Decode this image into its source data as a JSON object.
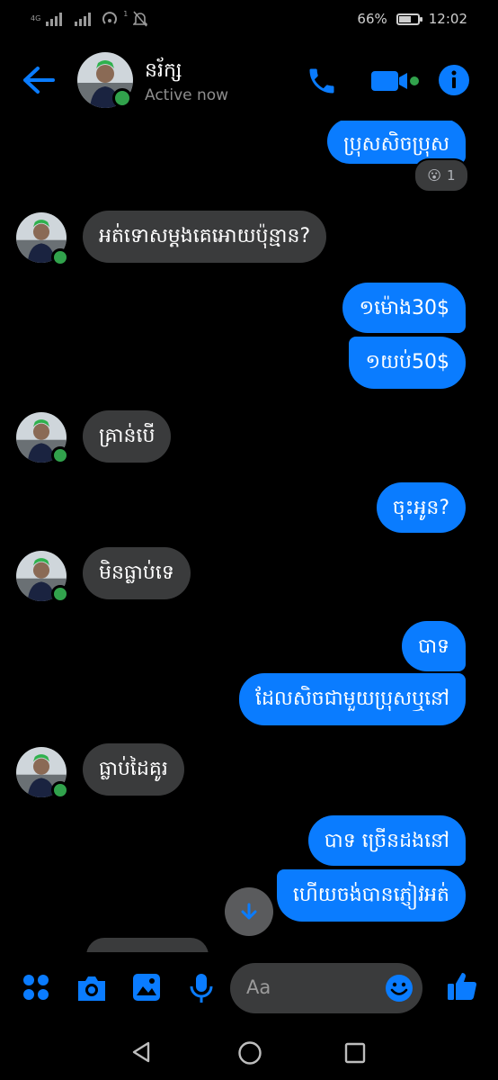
{
  "status_bar": {
    "network": "4G",
    "battery": "66%",
    "time": "12:02",
    "wifi_badge": "1"
  },
  "header": {
    "contact_name": "នរ័ក្ស",
    "presence": "Active now"
  },
  "messages": [
    {
      "side": "out",
      "text": "ប្រុសសិចប្រុស"
    },
    {
      "side": "in",
      "text": "អត់ទោសម្តងគេអោយប៉ុន្មាន?"
    },
    {
      "side": "out",
      "text": "១ម៉ោង30$"
    },
    {
      "side": "out",
      "text": "១យប់50$"
    },
    {
      "side": "in",
      "text": "គ្រាន់បើ"
    },
    {
      "side": "out",
      "text": "ចុះអូន?"
    },
    {
      "side": "in",
      "text": "មិនធ្លាប់ទេ"
    },
    {
      "side": "out",
      "text": "បាទ"
    },
    {
      "side": "out",
      "text": "ដែលសិចជាមួយប្រុសឬនៅ"
    },
    {
      "side": "in",
      "text": "ធ្លាប់ដៃគូរ"
    },
    {
      "side": "out",
      "text": "បាទ ច្រើនដងនៅ"
    },
    {
      "side": "out",
      "text": "ហើយចង់បានភ្ញៀវអត់"
    }
  ],
  "reaction": {
    "emoji": "😮",
    "count": "1"
  },
  "composer": {
    "placeholder": "Aa"
  },
  "colors": {
    "accent": "#0a7cff",
    "incoming": "#3a3b3c",
    "online": "#31a24c",
    "background": "#000000"
  },
  "icons": [
    "back-arrow-icon",
    "phone-icon",
    "video-icon",
    "info-icon",
    "apps-icon",
    "camera-icon",
    "gallery-icon",
    "mic-icon",
    "emoji-icon",
    "like-icon",
    "scroll-down-icon",
    "nav-back-icon",
    "nav-home-icon",
    "nav-recents-icon"
  ]
}
